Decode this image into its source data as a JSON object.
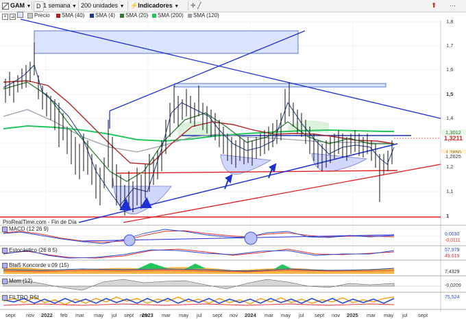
{
  "toolbar": {
    "symbol": "GAM",
    "period": "D",
    "timeframe": "1 semana",
    "units": "200 unidades",
    "indicators": "Indicadores",
    "bell_icon": "bell-icon",
    "more_icon": "more-icon"
  },
  "legend": {
    "price": "Precio",
    "items": [
      {
        "label": "SMA (40)",
        "color": "#b22222"
      },
      {
        "label": "SMA (4)",
        "color": "#1e3a8a"
      },
      {
        "label": "SMA (20)",
        "color": "#2e7d32"
      },
      {
        "label": "SMA (200)",
        "color": "#22c55e"
      },
      {
        "label": "SMA (120)",
        "color": "#9ca3af"
      }
    ]
  },
  "price_axis": {
    "ticks": [
      "1,8",
      "1,7",
      "1,6",
      "1,5",
      "1,4",
      "1,3",
      "1,2",
      "1,1",
      "1"
    ],
    "bold_ticks": [
      "1,5",
      "1"
    ]
  },
  "price_badges": {
    "last": "1,3211",
    "a": "1,3012",
    "b": "1,2850",
    "c": "1,2625"
  },
  "source_note": "ProRealTime.com - Fin de Día",
  "x_axis": [
    "sept",
    "nov",
    "2022",
    "feb",
    "mar",
    "may",
    "jul",
    "sept",
    "nov",
    "2023",
    "mar",
    "may",
    "jul",
    "sept",
    "nov",
    "2024",
    "mar",
    "may",
    "jul",
    "sept",
    "nov",
    "2025",
    "mar",
    "may",
    "jul",
    "sept"
  ],
  "x_axis_bold": [
    "2022",
    "2023",
    "2024",
    "2025"
  ],
  "indicators": [
    {
      "label": "MACD (12 26 9)",
      "values": [
        "0,0030",
        "-0,0111"
      ]
    },
    {
      "label": "Estocástico (26 8 5)",
      "values": [
        "57,979",
        "49,619"
      ]
    },
    {
      "label": "Blai5 Koncorde v.09 (15)",
      "values": [
        "",
        "7,4329"
      ]
    },
    {
      "label": "Mom (12)",
      "values": [
        "-0,0209"
      ]
    },
    {
      "label": "FILTRO RSI",
      "values": [
        "75,524"
      ]
    }
  ],
  "chart_data": {
    "type": "line",
    "title": "",
    "xlabel": "",
    "ylabel": "",
    "ylim": [
      0.97,
      1.83
    ],
    "grid": true,
    "approx_weekly_close": [
      1.62,
      1.6,
      1.58,
      1.55,
      1.6,
      1.75,
      1.57,
      1.52,
      1.5,
      1.46,
      1.44,
      1.4,
      1.35,
      1.33,
      1.37,
      1.28,
      1.2,
      1.13,
      1.1,
      1.08,
      1.03,
      1.06,
      1.16,
      1.11,
      1.23,
      1.31,
      1.47,
      1.52,
      1.43,
      1.49,
      1.43,
      1.44,
      1.41,
      1.33,
      1.3,
      1.27,
      1.31,
      1.26,
      1.31,
      1.33,
      1.36,
      1.49,
      1.41,
      1.37,
      1.31,
      1.29,
      1.3,
      1.33,
      1.31,
      1.31,
      1.29,
      1.19,
      1.24,
      1.27,
      1.32
    ]
  }
}
